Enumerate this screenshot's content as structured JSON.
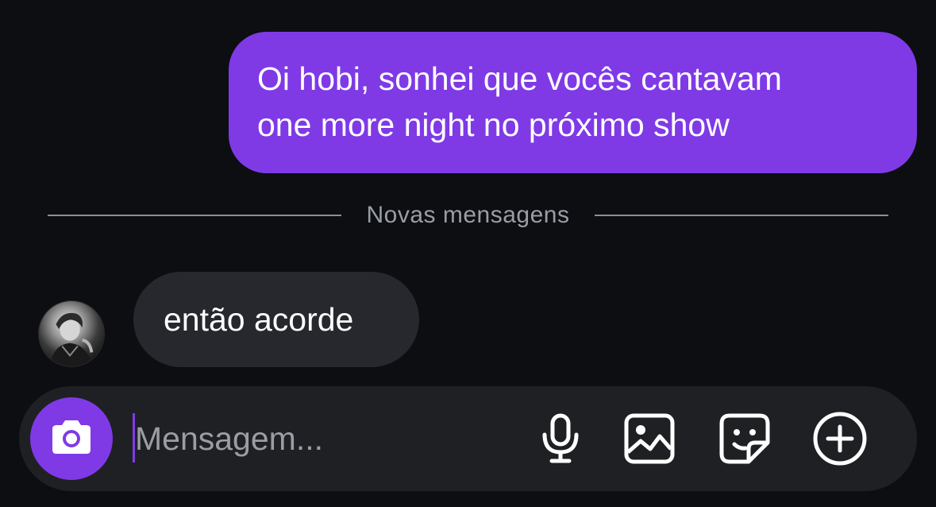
{
  "thread": {
    "outgoing_message": {
      "line1": "Oi hobi, sonhei que vocês cantavam",
      "line2": "one more night no próximo show"
    },
    "divider_label": "Novas mensagens",
    "incoming_message": "então acorde"
  },
  "composer": {
    "placeholder": "Mensagem...",
    "icons": [
      "camera-icon",
      "microphone-icon",
      "image-icon",
      "sticker-icon",
      "plus-circle-icon"
    ]
  },
  "colors": {
    "background": "#0c0e12",
    "accent": "#7f3ae6",
    "incoming_bubble": "#26282d",
    "composer_bg": "#1f2024",
    "muted_text": "#9a9da5"
  }
}
